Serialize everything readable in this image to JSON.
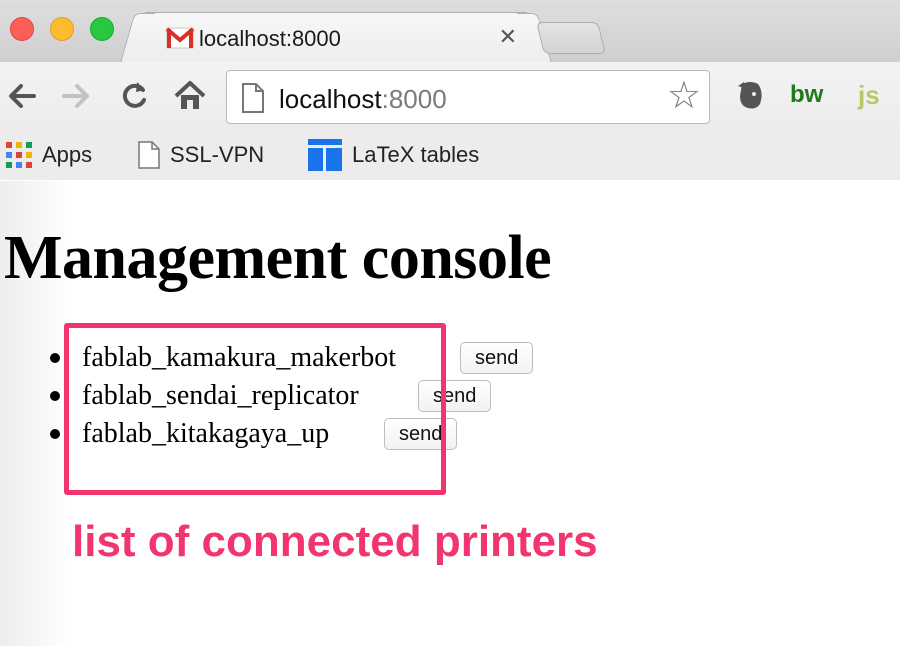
{
  "window": {
    "tab": {
      "title": "localhost:8000",
      "close_glyph": "✕",
      "favicon": "gmail-icon"
    }
  },
  "toolbar": {
    "url_host": "localhost",
    "url_port": ":8000",
    "star_glyph": "☆",
    "extensions": {
      "evernote": "evernote-icon",
      "bw": "bw",
      "js": "js"
    }
  },
  "bookmarks": [
    {
      "label": "Apps",
      "icon": "apps-grid-icon"
    },
    {
      "label": "SSL-VPN",
      "icon": "page-icon"
    },
    {
      "label": "LaTeX tables",
      "icon": "tables-icon"
    }
  ],
  "page": {
    "title": "Management console",
    "printers": [
      {
        "name": "fablab_kamakura_makerbot",
        "action": "send"
      },
      {
        "name": "fablab_sendai_replicator",
        "action": "send"
      },
      {
        "name": "fablab_kitakagaya_up",
        "action": "send"
      }
    ],
    "annotation": "list of connected printers"
  },
  "colors": {
    "annotation": "#f2356e"
  }
}
